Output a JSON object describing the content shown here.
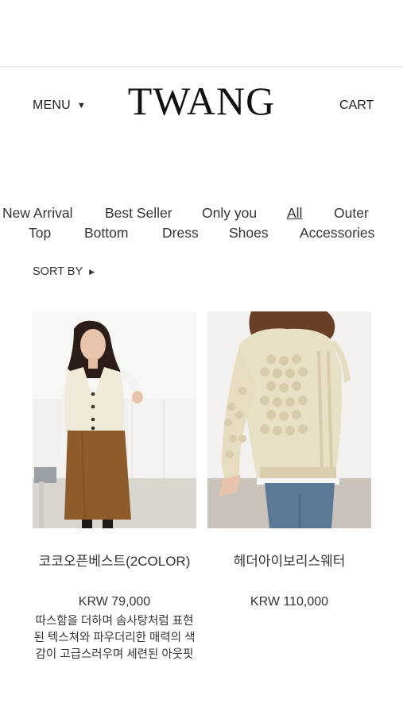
{
  "header": {
    "menu_label": "MENU",
    "logo": "TWANG",
    "cart_label": "CART"
  },
  "categories": {
    "new_arrival": "New Arrival",
    "best_seller": "Best Seller",
    "only_you": "Only you",
    "all": "All",
    "outer": "Outer",
    "top": "Top",
    "bottom": "Bottom",
    "dress": "Dress",
    "shoes": "Shoes",
    "accessories": "Accessories"
  },
  "sort": {
    "label": "SORT BY"
  },
  "products": [
    {
      "name": "코코오픈베스트(2COLOR)",
      "price": "KRW 79,000",
      "description": "따스함을 더하며 솜사탕처럼 표현된 텍스쳐와 파우더리한 매력의 색감이 고급스러우며 세련된 아웃핏"
    },
    {
      "name": "헤더아이보리스웨터",
      "price": "KRW 110,000"
    }
  ]
}
